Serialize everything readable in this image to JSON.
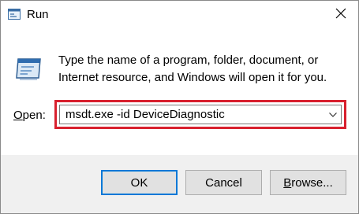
{
  "window": {
    "title": "Run",
    "title_icon": "run-icon",
    "close_icon": "close-icon"
  },
  "description": "Type the name of a program, folder, document, or Internet resource, and Windows will open it for you.",
  "open": {
    "label_accel": "O",
    "label_rest": "pen:",
    "value": "msdt.exe -id DeviceDiagnostic",
    "dropdown_icon": "chevron-down-icon"
  },
  "buttons": {
    "ok": "OK",
    "cancel": "Cancel",
    "browse_accel": "B",
    "browse_rest": "rowse..."
  },
  "colors": {
    "highlight": "#d8202e",
    "accent": "#0078d7",
    "footer_bg": "#f0f0f0"
  }
}
